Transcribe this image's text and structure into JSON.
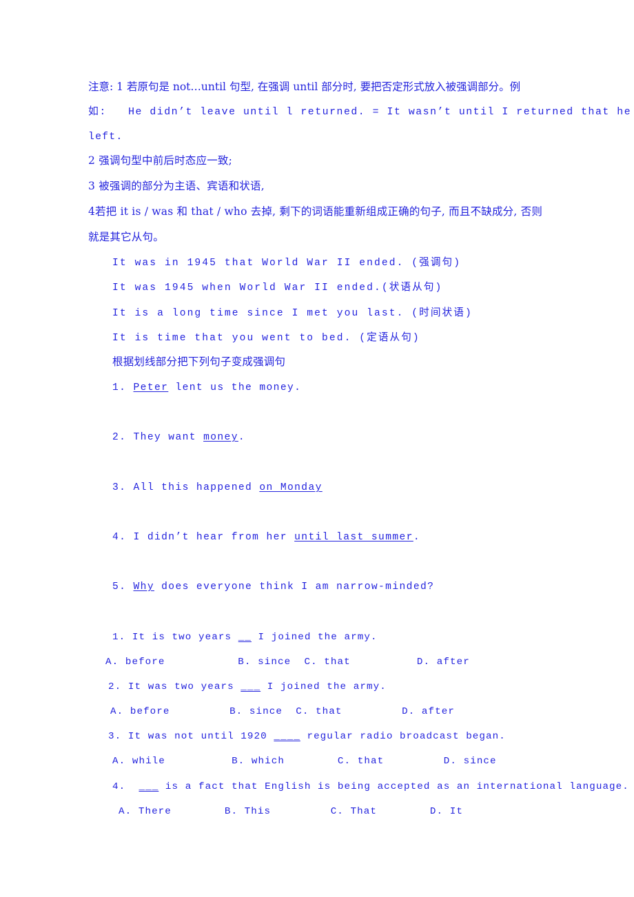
{
  "document": {
    "type": "worksheet",
    "subject": "English grammar — emphatic / cleft sentences (强调句)",
    "text_color": "#2323dd",
    "background_color": "#ffffff"
  },
  "notes": {
    "line1": "注意: 1 若原句是 not…until 句型, 在强调 until 部分时, 要把否定形式放入被强调部分。例",
    "line2": "如:   He didn’t leave until l returned. = It wasn’t until I returned that he",
    "line3": "left.",
    "line4": "2 强调句型中前后时态应一致;",
    "line5": "3 被强调的部分为主语、宾语和状语,",
    "line6": "4若把 it is / was 和 that / who 去掉, 剩下的词语能重新组成正确的句子, 而且不缺成分, 否则",
    "line7": "就是其它从句。"
  },
  "examples": [
    "It was in 1945 that World War II ended. (强调句)",
    "It was 1945 when World War II ended.(状语从句)",
    "It is a long time since I met you last. (时间状语)",
    "It is time that you went to bed. (定语从句)"
  ],
  "rewrite_section": {
    "instruction": "根据划线部分把下列句子变成强调句",
    "items": [
      {
        "number": "1.",
        "pre": "",
        "underlined": "Peter",
        "post": " lent us the money."
      },
      {
        "number": "2.",
        "pre": "They want ",
        "underlined": "money",
        "post": "."
      },
      {
        "number": "3.",
        "pre": "All this happened ",
        "underlined": "on Monday",
        "post": ""
      },
      {
        "number": "4.",
        "pre": "I didn’t hear from her ",
        "underlined": "until last summer",
        "post": "."
      },
      {
        "number": "5.",
        "pre": "",
        "underlined": "Why",
        "post": " does everyone think I am narrow-minded?"
      }
    ]
  },
  "multiple_choice": [
    {
      "number": "1.",
      "stem_pre": "It is two years ",
      "blank": "__",
      "stem_post": " I joined the army.",
      "options": [
        "A. before",
        "B. since",
        "C. that",
        "D. after"
      ]
    },
    {
      "number": "2.",
      "stem_pre": "It was two years ",
      "blank": "___",
      "stem_post": " I joined the army.",
      "options": [
        "A. before",
        "B. since",
        "C. that",
        "D. after"
      ]
    },
    {
      "number": "3.",
      "stem_pre": "It was not until 1920 ",
      "blank": "____",
      "stem_post": " regular radio broadcast began.",
      "options": [
        "A. while",
        "B. which",
        "C. that",
        "D. since"
      ]
    },
    {
      "number": "4.",
      "stem_pre": "",
      "blank": "___",
      "stem_post": " is a fact that English is being accepted as an international language.",
      "options": [
        "A. There",
        "B. This",
        "C. That",
        "D. It"
      ]
    }
  ]
}
